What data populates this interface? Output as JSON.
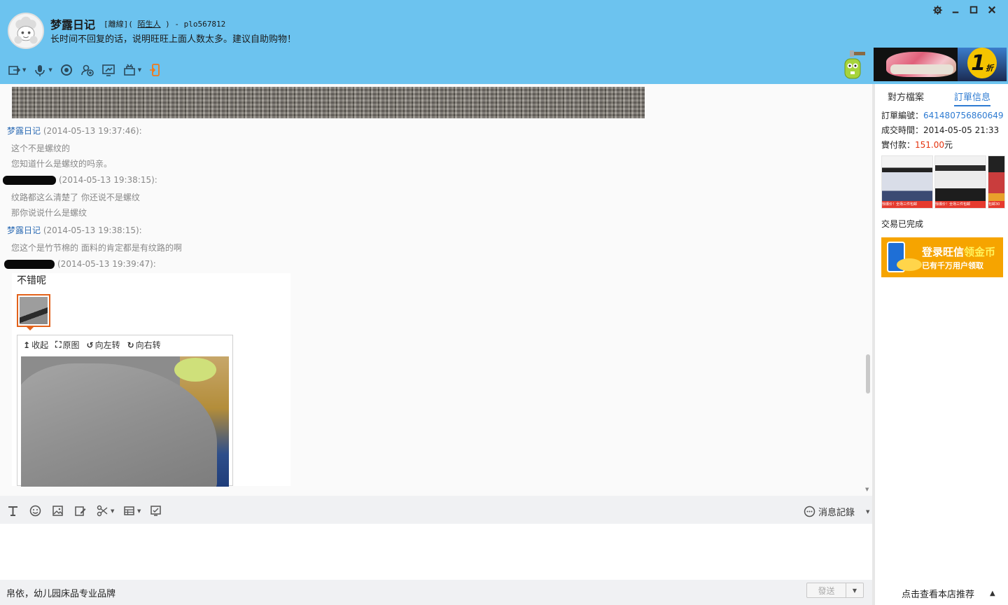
{
  "header": {
    "nickname": "梦露日记",
    "status_label": "[離線](",
    "status_link": "陌生人",
    "status_suffix": ") - plo567812",
    "signature": "长时间不回复的话，说明旺旺上面人数太多。建议自助购物！"
  },
  "window_controls": [
    "gear-icon",
    "minimize-icon",
    "maximize-icon",
    "close-icon"
  ],
  "toolbar_icons": [
    "send-file-icon",
    "voice-icon",
    "video-icon",
    "add-contact-icon",
    "screen-share-icon",
    "remote-assist-icon",
    "mobile-icon"
  ],
  "banner_ad": {
    "discount": "1",
    "unit": "折"
  },
  "messages": [
    {
      "sender": "梦露日记",
      "redacted": false,
      "time": "(2014-05-13 19:37:46):",
      "lines": [
        "这个不是螺纹的",
        "您知道什么是螺纹的吗亲。"
      ]
    },
    {
      "sender": "",
      "redacted": true,
      "time": "(2014-05-13 19:38:15):",
      "lines": [
        "纹路都这么清楚了 你还说不是螺纹",
        "那你说说什么是螺纹"
      ]
    },
    {
      "sender": "梦露日记",
      "redacted": false,
      "time": "(2014-05-13 19:38:15):",
      "lines": [
        "您这个是竹节棉的 面料的肯定都是有纹路的啊"
      ]
    },
    {
      "sender": "",
      "redacted": true,
      "time": "(2014-05-13 19:39:47):",
      "lines": [
        "不错呢"
      ]
    }
  ],
  "image_viewer": {
    "collapse": "收起",
    "original": "原图",
    "rotate_left": "向左转",
    "rotate_right": "向右转"
  },
  "input_toolbar": {
    "icons": [
      "font-icon",
      "emoji-icon",
      "image-icon",
      "edit-icon",
      "scissors-icon",
      "table-icon",
      "screen-icon"
    ],
    "history_label": "消息記錄"
  },
  "footer": {
    "shop_name": "帛依，幼儿园床品专业品牌",
    "send_label": "發送"
  },
  "right_panel": {
    "tabs": [
      {
        "label": "對方檔案",
        "active": false
      },
      {
        "label": "訂單信息",
        "active": true
      }
    ],
    "order_no_label": "訂單編號：",
    "order_no": "641480756860649",
    "deal_time_label": "成交時間：",
    "deal_time": "2014-05-05 21:33",
    "paid_label": "實付款：",
    "paid_value": "151.00",
    "paid_unit": "元",
    "product_tag": "惊爆价！全场三件包邮",
    "product_tag_short": "包邮30",
    "deal_status": "交易已完成",
    "coin_ad_title_a": "登录旺信",
    "coin_ad_title_b": "领金币",
    "coin_ad_sub": "已有千万用户领取",
    "recommend": "点击查看本店推荐"
  },
  "colors": {
    "header_bg": "#6cc3ef",
    "link_blue": "#2e7bd2",
    "price_red": "#e4320d",
    "thumb_border": "#e2621b",
    "coin_ad_bg": "#f6a400"
  }
}
